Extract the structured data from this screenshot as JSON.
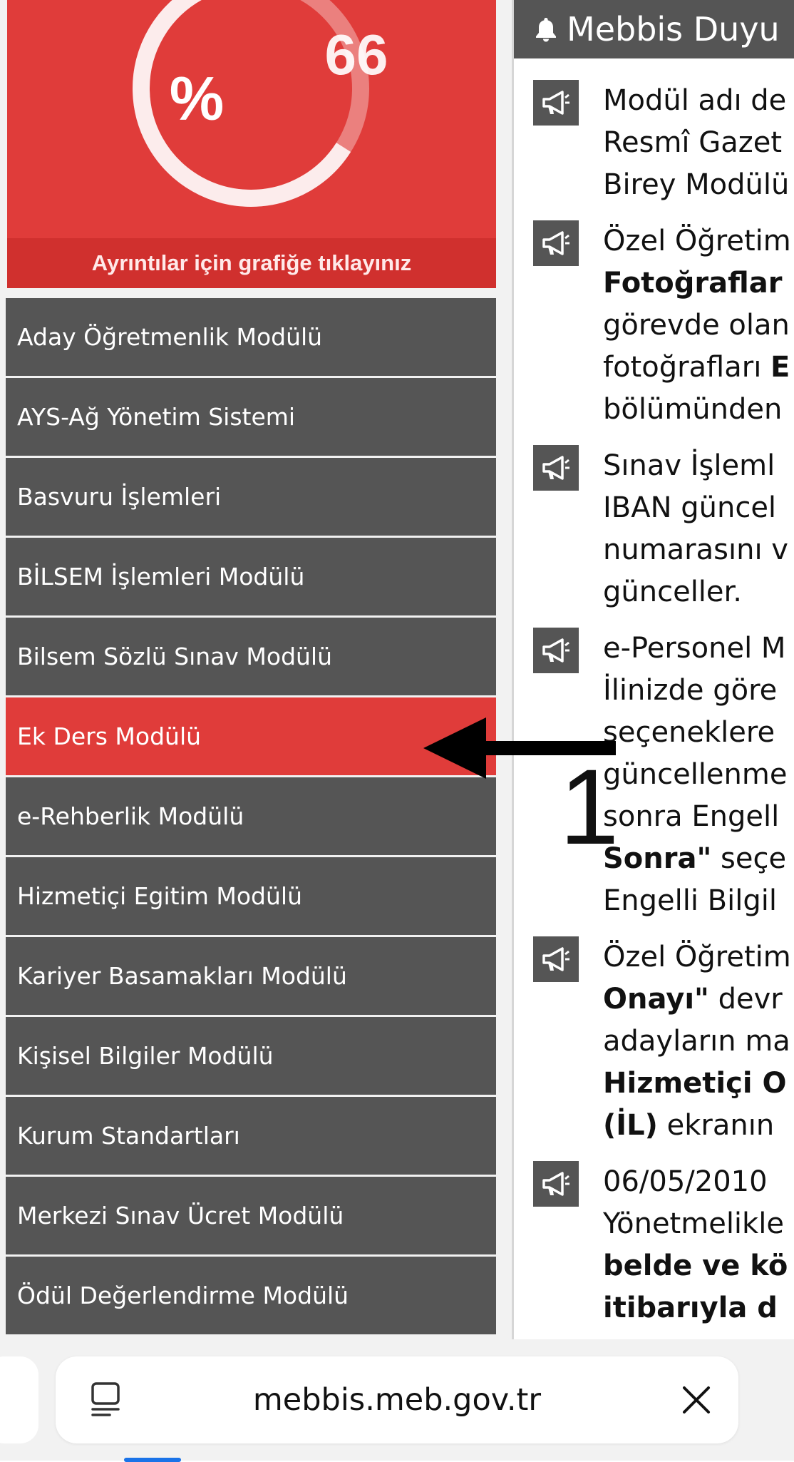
{
  "chart_panel": {
    "percent_symbol": "%",
    "value_label": "66",
    "progress": 0.66,
    "footer_text": "Ayrıntılar için grafiğe tıklayınız",
    "colors": {
      "background": "#e03c3a",
      "footer": "#d0302e"
    }
  },
  "menu": {
    "items": [
      {
        "label": "Aday Öğretmenlik Modülü",
        "active": false
      },
      {
        "label": "AYS-Ağ Yönetim Sistemi",
        "active": false
      },
      {
        "label": "Basvuru İşlemleri",
        "active": false
      },
      {
        "label": "BİLSEM İşlemleri Modülü",
        "active": false
      },
      {
        "label": "Bilsem Sözlü Sınav Modülü",
        "active": false
      },
      {
        "label": "Ek Ders Modülü",
        "active": true
      },
      {
        "label": "e-Rehberlik Modülü",
        "active": false
      },
      {
        "label": "Hizmetiçi Egitim Modülü",
        "active": false
      },
      {
        "label": "Kariyer Basamakları Modülü",
        "active": false
      },
      {
        "label": "Kişisel Bilgiler Modülü",
        "active": false
      },
      {
        "label": "Kurum Standartları",
        "active": false
      },
      {
        "label": "Merkezi Sınav Ücret Modülü",
        "active": false
      },
      {
        "label": "Ödül Değerlendirme Modülü",
        "active": false
      }
    ],
    "colors": {
      "item": "#555555",
      "active": "#e03c3a"
    }
  },
  "announcements": {
    "header_title": "Mebbis Duyu",
    "header_icon": "bell-icon",
    "item_icon": "megaphone-icon",
    "items": [
      {
        "lines": [
          [
            {
              "t": "Modül adı de"
            }
          ],
          [
            {
              "t": "Resmî Gazet"
            }
          ],
          [
            {
              "t": "Birey Modülü"
            }
          ]
        ]
      },
      {
        "lines": [
          [
            {
              "t": "Özel Öğretim"
            }
          ],
          [
            {
              "t": "Fotoğraflar",
              "b": true
            }
          ],
          [
            {
              "t": "görevde olan"
            }
          ],
          [
            {
              "t": "fotoğrafları "
            },
            {
              "t": "E",
              "b": true
            }
          ],
          [
            {
              "t": "bölümünden"
            }
          ]
        ]
      },
      {
        "lines": [
          [
            {
              "t": "Sınav İşleml"
            }
          ],
          [
            {
              "t": "IBAN güncel"
            }
          ],
          [
            {
              "t": "numarasını v"
            }
          ],
          [
            {
              "t": "günceller."
            }
          ]
        ]
      },
      {
        "lines": [
          [
            {
              "t": "e-Personel M"
            }
          ],
          [
            {
              "t": "İlinizde göre"
            }
          ],
          [
            {
              "t": "seçeneklere"
            }
          ],
          [
            {
              "t": "güncellenme"
            }
          ],
          [
            {
              "t": "sonra Engell"
            }
          ],
          [
            {
              "t": "Sonra\"",
              "b": true
            },
            {
              "t": " seçe"
            }
          ],
          [
            {
              "t": "Engelli Bilgil"
            }
          ]
        ]
      },
      {
        "lines": [
          [
            {
              "t": "Özel Öğretim"
            }
          ],
          [
            {
              "t": "Onayı\"",
              "b": true
            },
            {
              "t": " devr"
            }
          ],
          [
            {
              "t": "adayların ma"
            }
          ],
          [
            {
              "t": "Hizmetiçi O",
              "b": true
            }
          ],
          [
            {
              "t": "(İL)",
              "b": true
            },
            {
              "t": " ekranın"
            }
          ]
        ]
      },
      {
        "lines": [
          [
            {
              "t": "06/05/2010"
            }
          ],
          [
            {
              "t": "Yönetmelikle"
            }
          ],
          [
            {
              "t": "belde ve kö",
              "b": true
            }
          ],
          [
            {
              "t": "itibarıyla d",
              "b": true
            }
          ]
        ]
      }
    ]
  },
  "annotation": {
    "arrow_icon": "arrow-left-icon",
    "step_number": "1"
  },
  "browser": {
    "url": "mebbis.meb.gov.tr",
    "reader_icon": "reader-mode-icon",
    "close_icon": "close-icon",
    "progress_color": "#1a73e8"
  }
}
